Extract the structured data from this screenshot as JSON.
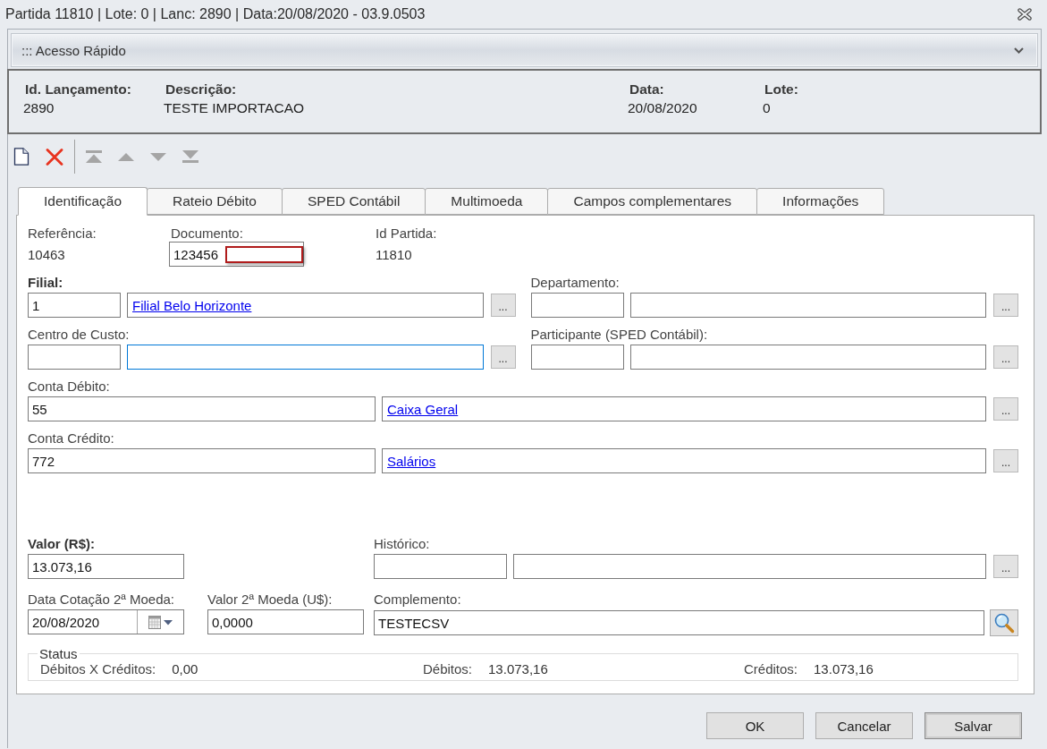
{
  "window": {
    "title": "Partida 11810 | Lote: 0 | Lanc: 2890 | Data:20/08/2020 - 03.9.0503"
  },
  "quick_access": {
    "title": "::: Acesso Rápido",
    "expanded": false
  },
  "header": {
    "fields": [
      {
        "label": "Id. Lançamento:",
        "value": "2890"
      },
      {
        "label": "Descrição:",
        "value": "TESTE IMPORTACAO"
      },
      {
        "label": "Data:",
        "value": "20/08/2020"
      },
      {
        "label": "Lote:",
        "value": "0"
      }
    ]
  },
  "toolbar": {
    "groups": [
      [
        {
          "kind": "new",
          "disabled": false
        },
        {
          "kind": "delete",
          "disabled": false
        }
      ],
      [
        {
          "kind": "first",
          "disabled": true
        },
        {
          "kind": "previous",
          "disabled": true
        },
        {
          "kind": "next",
          "disabled": true
        },
        {
          "kind": "last",
          "disabled": true
        }
      ]
    ]
  },
  "tabs": [
    {
      "label": "Identificação",
      "selected": true
    },
    {
      "label": "Rateio Débito",
      "selected": false
    },
    {
      "label": "SPED Contábil",
      "selected": false
    },
    {
      "label": "Multimoeda",
      "selected": false
    },
    {
      "label": "Campos complementares",
      "selected": false
    },
    {
      "label": "Informações",
      "selected": false
    }
  ],
  "reference": {
    "label": "Referência:",
    "value": "10463"
  },
  "document": {
    "label": "Documento:",
    "value": "123456",
    "error": true
  },
  "entry_id": {
    "label": "Id Partida:",
    "value": "11810"
  },
  "entity_lookups": [
    {
      "label": "Filial:",
      "required": true,
      "code": "1",
      "name": "Filial Belo Horizonte",
      "focused": false,
      "button": "..."
    },
    {
      "label": "Departamento:",
      "required": false,
      "focused": false,
      "button": "..."
    },
    {
      "label": "Centro de Custo:",
      "required": false,
      "focused": true,
      "button": "..."
    },
    {
      "label": "Participante (SPED Contábil):",
      "required": false,
      "focused": false,
      "button": "..."
    }
  ],
  "account_lookups": [
    {
      "label": "Conta Débito:",
      "required": false,
      "code": "55",
      "name": "Caixa Geral",
      "focused": false,
      "button": "..."
    },
    {
      "label": "Conta Crédito:",
      "required": false,
      "code": "772",
      "name": "Salários",
      "focused": false,
      "button": "..."
    }
  ],
  "amount": {
    "label": "Valor (R$):",
    "required": true,
    "value": "13.073,16"
  },
  "history": {
    "label": "Histórico:",
    "required": false,
    "focused": false,
    "button": "..."
  },
  "quote_date": {
    "label": "Data Cotação 2ª Moeda:",
    "required": false,
    "value": "20/08/2020"
  },
  "second_currency_value": {
    "label": "Valor 2ª Moeda (U$):",
    "required": false,
    "value": "0,0000"
  },
  "complement": {
    "label": "Complemento:",
    "required": false,
    "value": "TESTECSV"
  },
  "status": {
    "legend": "Status",
    "items": [
      {
        "label": "Débitos X Créditos:",
        "value": "0,00"
      },
      {
        "label": "Débitos:",
        "value": "13.073,16"
      },
      {
        "label": "Créditos:",
        "value": "13.073,16"
      }
    ]
  },
  "buttons": [
    {
      "label": "OK",
      "default": false
    },
    {
      "label": "Cancelar",
      "default": false
    },
    {
      "label": "Salvar",
      "default": true
    }
  ]
}
